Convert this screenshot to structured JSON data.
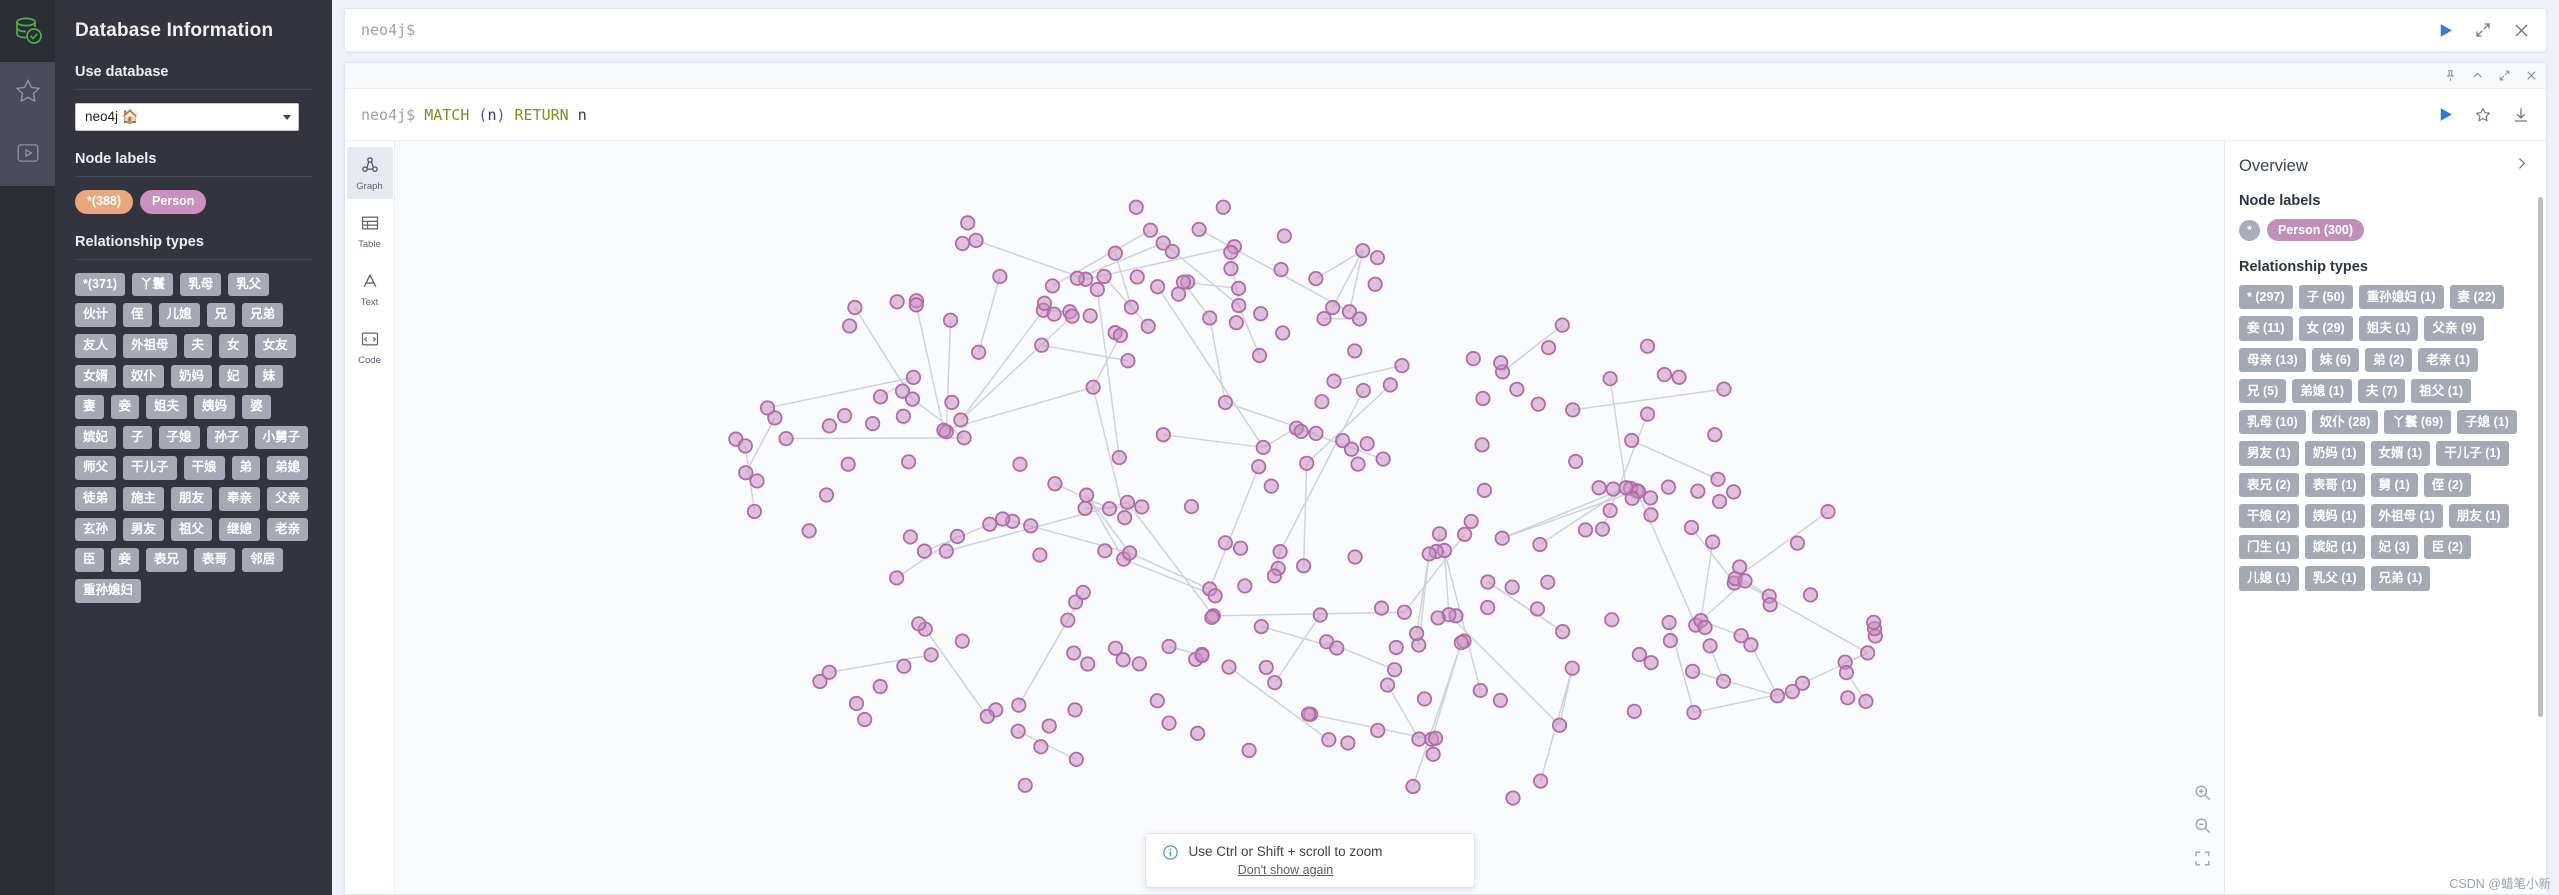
{
  "rail": {
    "logo_icon": "neo4j-database-check-logo",
    "items": [
      {
        "icon": "star-icon",
        "name": "favorites"
      },
      {
        "icon": "play-circle-icon",
        "name": "project-files"
      }
    ]
  },
  "sidebar": {
    "title": "Database Information",
    "use_database": {
      "heading": "Use database",
      "selected": "neo4j 🏠",
      "caret_icon": "chevron-down-icon"
    },
    "node_labels": {
      "heading": "Node labels",
      "chips": [
        {
          "label": "*(388)",
          "color": "#e8a77d"
        },
        {
          "label": "Person",
          "color": "#c990c0"
        }
      ]
    },
    "relationship_types": {
      "heading": "Relationship types",
      "chips": [
        "*(371)",
        "丫鬟",
        "乳母",
        "乳父",
        "伙计",
        "侄",
        "儿媳",
        "兄",
        "兄弟",
        "友人",
        "外祖母",
        "夫",
        "女",
        "女友",
        "女婿",
        "奴仆",
        "奶妈",
        "妃",
        "妹",
        "妻",
        "妾",
        "姐夫",
        "姨妈",
        "婆",
        "嫔妃",
        "子",
        "子媳",
        "孙子",
        "小舅子",
        "师父",
        "干儿子",
        "干娘",
        "弟",
        "弟媳",
        "徒弟",
        "施主",
        "朋友",
        "奉亲",
        "父亲",
        "玄孙",
        "男友",
        "祖父",
        "继媳",
        "老亲",
        "臣",
        "妾",
        "表兄",
        "表哥",
        "邻居",
        "重孙媳妇"
      ]
    }
  },
  "editor": {
    "prompt": "neo4j$",
    "run_icon": "play-icon",
    "expand_icon": "expand-icon",
    "close_icon": "close-icon"
  },
  "frame": {
    "toolbar_icons": [
      "pin-icon",
      "collapse-up-icon",
      "expand-icon",
      "close-icon"
    ],
    "query": {
      "prompt": "neo4j$",
      "keyword1": "MATCH",
      "open_paren": "(",
      "var1": "n",
      "close_paren": ")",
      "keyword2": "RETURN",
      "var2": "n"
    },
    "actions": [
      "play-icon",
      "star-icon",
      "download-icon"
    ],
    "view_tabs": [
      {
        "label": "Graph",
        "icon": "graph-icon",
        "active": true
      },
      {
        "label": "Table",
        "icon": "table-icon",
        "active": false
      },
      {
        "label": "Text",
        "icon": "text-icon",
        "active": false
      },
      {
        "label": "Code",
        "icon": "code-icon",
        "active": false
      }
    ],
    "zoom_controls": [
      "zoom-in-icon",
      "zoom-out-icon",
      "fit-to-screen-icon"
    ],
    "tooltip": {
      "icon": "info-icon",
      "text": "Use Ctrl or Shift + scroll to zoom",
      "dismiss": "Don't show again"
    }
  },
  "overview": {
    "title": "Overview",
    "collapse_icon": "chevron-right-icon",
    "node_labels": {
      "heading": "Node labels",
      "star": "*",
      "chips": [
        {
          "label": "Person (300)",
          "color": "#c28fb8"
        }
      ]
    },
    "relationship_types": {
      "heading": "Relationship types",
      "chips": [
        "* (297)",
        "子 (50)",
        "重孙媳妇 (1)",
        "妻 (22)",
        "妾 (11)",
        "女 (29)",
        "姐夫 (1)",
        "父亲 (9)",
        "母亲 (13)",
        "妹 (6)",
        "弟 (2)",
        "老亲 (1)",
        "兄 (5)",
        "弟媳 (1)",
        "夫 (7)",
        "祖父 (1)",
        "乳母 (10)",
        "奴仆 (28)",
        "丫鬟 (69)",
        "子媳 (1)",
        "男友 (1)",
        "奶妈 (1)",
        "女婿 (1)",
        "干儿子 (1)",
        "表兄 (2)",
        "表哥 (1)",
        "舅 (1)",
        "侄 (2)",
        "干娘 (2)",
        "姨妈 (1)",
        "外祖母 (1)",
        "朋友 (1)",
        "门生 (1)",
        "嫔妃 (1)",
        "妃 (3)",
        "臣 (2)",
        "儿媳 (1)",
        "乳父 (1)",
        "兄弟 (1)"
      ]
    }
  },
  "watermark": "CSDN @蜡笔小新",
  "colors": {
    "sidebar_bg": "#33343d",
    "rail_bg": "#2b2d35",
    "accent_blue": "#2f7dd1",
    "node_purple": "#c990c0",
    "chip_gray": "#a5a9b4",
    "logo_green": "#4caf50"
  },
  "graph": {
    "node_color": "#c990c0",
    "node_stroke": "#b06aa8",
    "edge_color": "#cfd2da",
    "node_count": 300
  }
}
